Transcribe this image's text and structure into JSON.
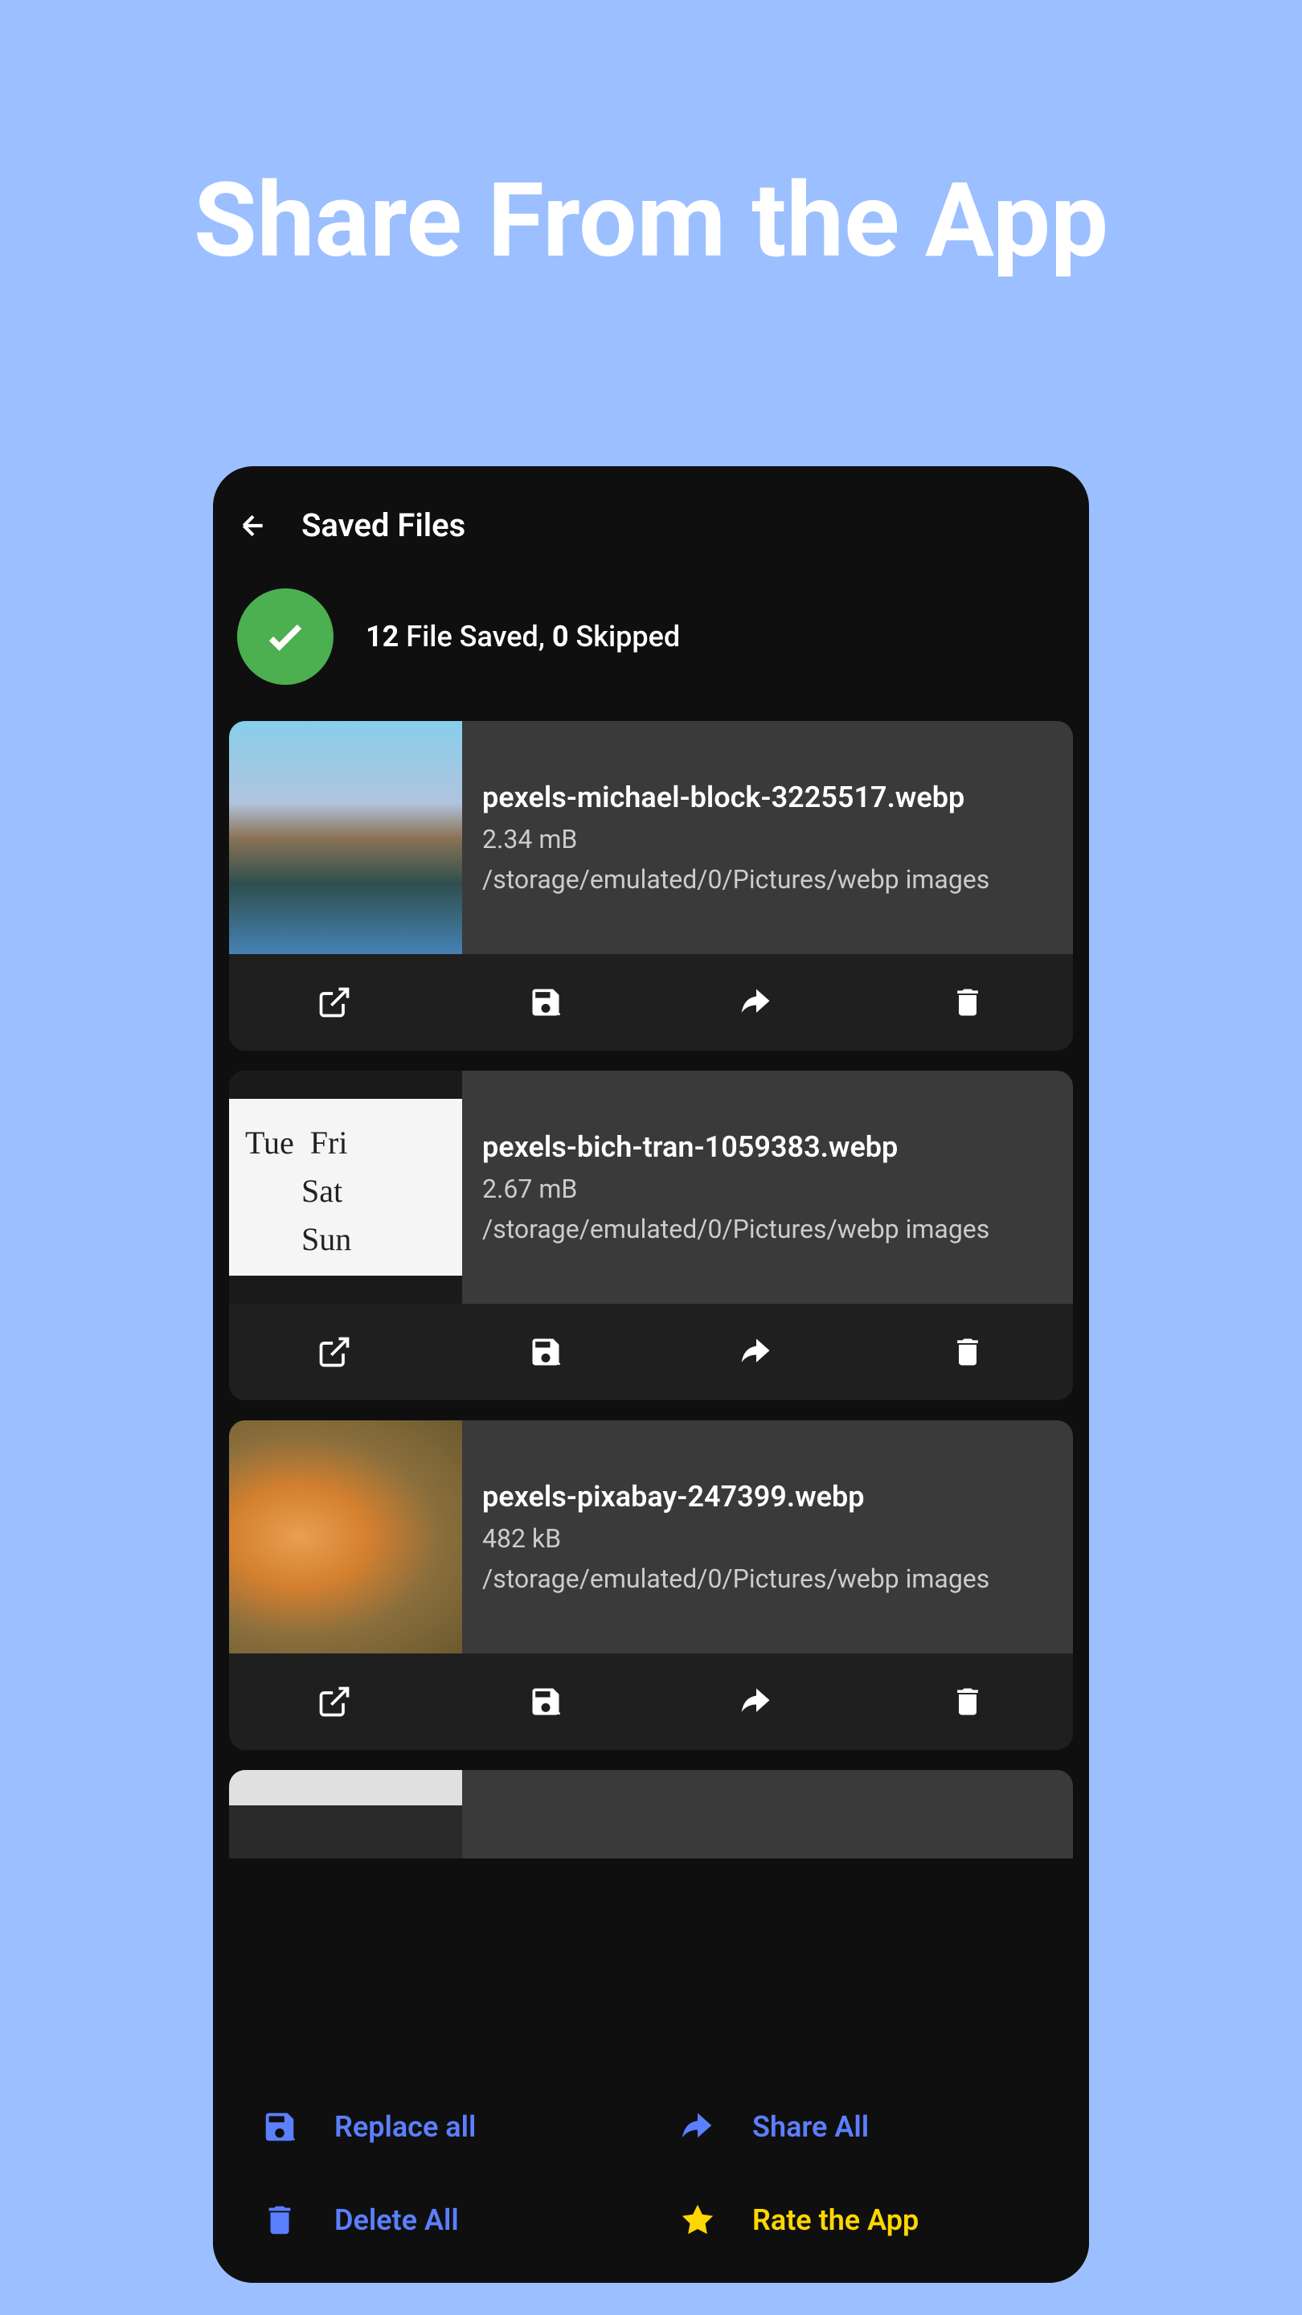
{
  "marketing": {
    "title": "Share From the App"
  },
  "header": {
    "title": "Saved Files"
  },
  "status": {
    "saved_count": "12",
    "saved_label": "File Saved,",
    "skipped_count": "0",
    "skipped_label": "Skipped"
  },
  "files": [
    {
      "name": "pexels-michael-block-3225517.webp",
      "size": "2.34 mB",
      "path": "/storage/emulated/0/Pictures/webp images"
    },
    {
      "name": "pexels-bich-tran-1059383.webp",
      "size": "2.67 mB",
      "path": "/storage/emulated/0/Pictures/webp images"
    },
    {
      "name": "pexels-pixabay-247399.webp",
      "size": "482 kB",
      "path": "/storage/emulated/0/Pictures/webp images"
    }
  ],
  "bottom_actions": {
    "replace_all": "Replace all",
    "share_all": "Share All",
    "delete_all": "Delete All",
    "rate_app": "Rate the App"
  }
}
